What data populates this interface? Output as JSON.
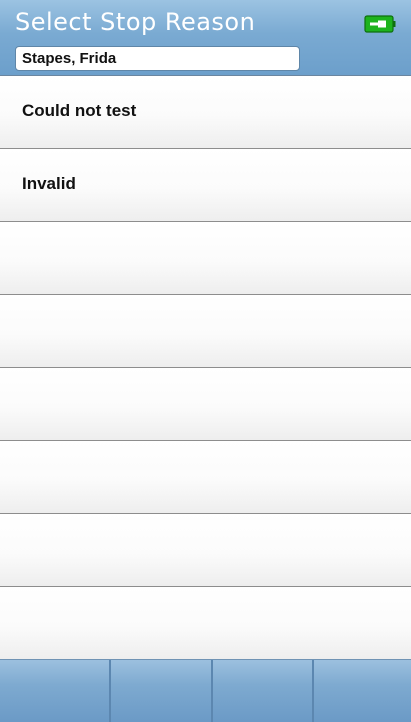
{
  "header": {
    "title": "Select Stop Reason",
    "patient_name": "Stapes, Frida",
    "battery_icon": "battery-icon",
    "battery_color": "#1db31d"
  },
  "reasons": [
    {
      "label": "Could not test"
    },
    {
      "label": "Invalid"
    },
    {
      "label": ""
    },
    {
      "label": ""
    },
    {
      "label": ""
    },
    {
      "label": ""
    },
    {
      "label": ""
    },
    {
      "label": ""
    }
  ],
  "softkeys": [
    {
      "label": ""
    },
    {
      "label": ""
    },
    {
      "label": ""
    },
    {
      "label": ""
    }
  ]
}
